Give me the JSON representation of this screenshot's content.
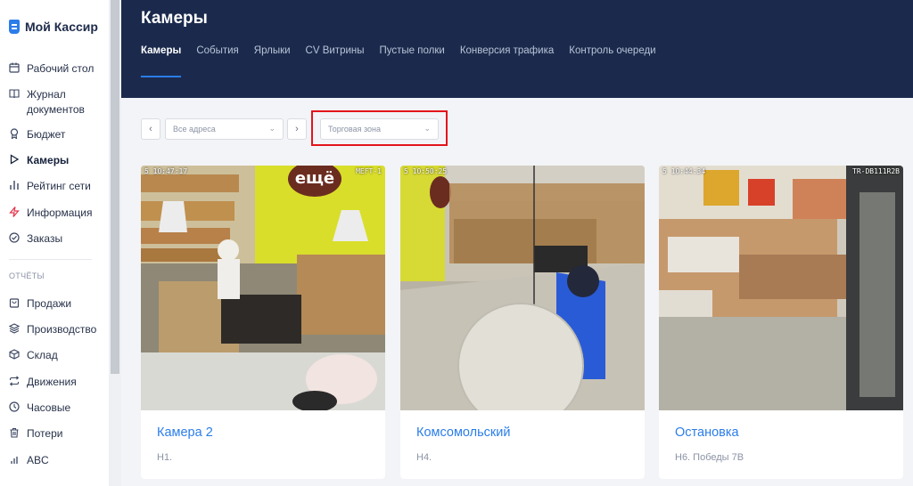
{
  "brand": {
    "name": "Мой Кассир"
  },
  "sidebar": {
    "items": [
      {
        "label": "Рабочий стол",
        "icon": "calendar-icon"
      },
      {
        "label": "Журнал документов",
        "icon": "book-icon"
      },
      {
        "label": "Бюджет",
        "icon": "award-icon"
      },
      {
        "label": "Камеры",
        "icon": "play-icon",
        "active": true
      },
      {
        "label": "Рейтинг сети",
        "icon": "bar-chart-icon"
      },
      {
        "label": "Информация",
        "icon": "lightning-icon"
      },
      {
        "label": "Заказы",
        "icon": "check-circle-icon"
      }
    ],
    "section_title": "ОТЧЁТЫ",
    "report_items": [
      {
        "label": "Продажи",
        "icon": "bag-icon"
      },
      {
        "label": "Производство",
        "icon": "layers-icon"
      },
      {
        "label": "Склад",
        "icon": "box-icon"
      },
      {
        "label": "Движения",
        "icon": "repeat-icon"
      },
      {
        "label": "Часовые",
        "icon": "clock-icon"
      },
      {
        "label": "Потери",
        "icon": "trash-icon"
      },
      {
        "label": "ABC",
        "icon": "bar-chart-small-icon"
      }
    ]
  },
  "header": {
    "title": "Камеры",
    "tabs": [
      "Камеры",
      "События",
      "Ярлыки",
      "CV Витрины",
      "Пустые полки",
      "Конверсия трафика",
      "Контроль очереди"
    ]
  },
  "filters": {
    "address_placeholder": "Все адреса",
    "zone_placeholder": "Торговая зона"
  },
  "cameras": [
    {
      "name": "Камера 2",
      "address": "Н1.",
      "timestamp": "5 10:47:17",
      "label_top": "MEFT-1"
    },
    {
      "name": "Комсомольский",
      "address": "Н4.",
      "timestamp": "5 10:50:25",
      "label_top": ""
    },
    {
      "name": "Остановка",
      "address": "Н6. Победы 7В",
      "timestamp": "5 10:44:34",
      "label_top": "TR-DB111R2B"
    }
  ],
  "colors": {
    "accent": "#2b7de9",
    "header_bg": "#1b2a4c",
    "highlight": "#e3141b",
    "brand_yellow": "#d9de2a"
  }
}
